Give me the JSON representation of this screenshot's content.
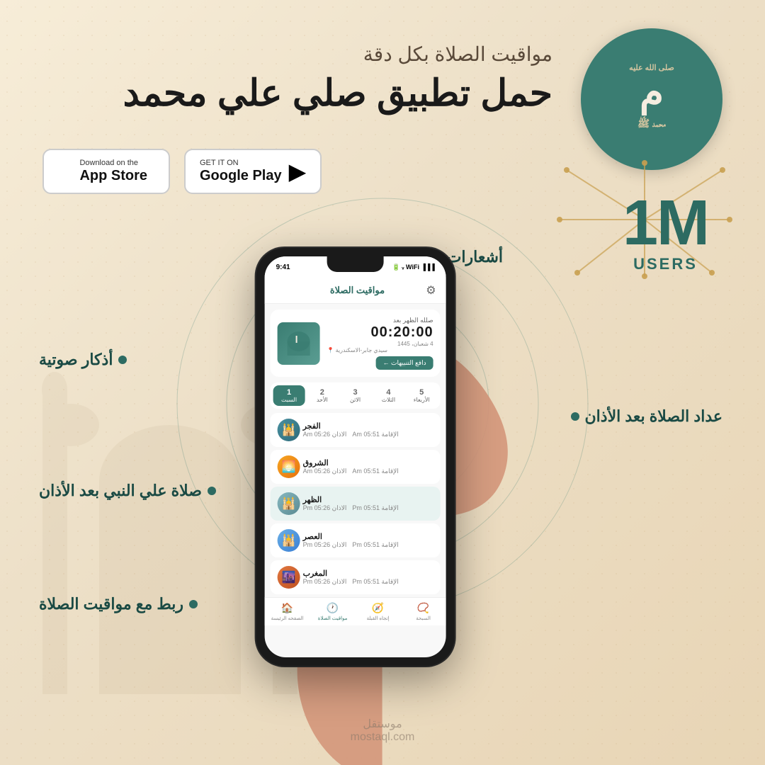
{
  "page": {
    "background": "#f5ede0"
  },
  "header": {
    "subtitle": "مواقيت الصلاة بكل دقة",
    "title": "حمل تطبيق صلي علي محمد"
  },
  "logo": {
    "symbol": "محمد",
    "background_color": "#3a7d72"
  },
  "million_badge": {
    "number": "1M",
    "label": "USERS"
  },
  "store_buttons": [
    {
      "id": "google-play",
      "pre_label": "GET IT ON",
      "name": "Google Play",
      "icon": "▶"
    },
    {
      "id": "app-store",
      "pre_label": "Download on the",
      "name": "App Store",
      "icon": ""
    }
  ],
  "features": [
    {
      "id": "custom-notifications",
      "text": "أشعارات مخصصط بعد الصلاة",
      "position": "top-right"
    },
    {
      "id": "audio-dhikr",
      "text": "أذكار صوتية",
      "position": "left-upper"
    },
    {
      "id": "prayer-count",
      "text": "عداد الصلاة بعد الأذان",
      "position": "right-middle"
    },
    {
      "id": "salawat",
      "text": "صلاة علي النبي بعد الأذان",
      "position": "left-lower"
    },
    {
      "id": "prayer-times-link",
      "text": "ربط مع مواقيت الصلاة",
      "position": "bottom-left"
    }
  ],
  "phone": {
    "time": "9:41",
    "app_title": "مواقيت الصلاة",
    "next_prayer_label": "صلله الظهر بعد",
    "countdown": "00:20:00",
    "date_hijri": "4 شعبان، 1445",
    "location": "سيدي جابر-الاسكندرية",
    "reminder_btn": "دافع التنبيهات ←",
    "days": [
      {
        "num": "1",
        "name": "السبت",
        "active": true
      },
      {
        "num": "2",
        "name": "الأحد",
        "active": false
      },
      {
        "num": "3",
        "name": "الاثن",
        "active": false
      },
      {
        "num": "4",
        "name": "الثلاث",
        "active": false
      },
      {
        "num": "5",
        "name": "الأربعاء",
        "active": false
      }
    ],
    "prayers": [
      {
        "name": "الفجر",
        "adhan": "05:26 Am",
        "iqama": "05:51 Am",
        "highlighted": false,
        "icon": "🕌"
      },
      {
        "name": "الشروق",
        "adhan": "05:26 Am",
        "iqama": "05:51 Am",
        "highlighted": false,
        "icon": "🌅"
      },
      {
        "name": "الظهر",
        "adhan": "05:26 Pm",
        "iqama": "05:51 Pm",
        "highlighted": true,
        "icon": "🕌"
      },
      {
        "name": "العصر",
        "adhan": "05:26 Pm",
        "iqama": "05:51 Pm",
        "highlighted": false,
        "icon": "🕌"
      },
      {
        "name": "المغرب",
        "adhan": "05:26 Pm",
        "iqama": "05:51 Pm",
        "highlighted": false,
        "icon": "🌆"
      }
    ],
    "nav_items": [
      {
        "id": "tasbih",
        "label": "السبحة",
        "icon": "📿",
        "active": false
      },
      {
        "id": "qibla",
        "label": "إتجاه القبلة",
        "icon": "🧭",
        "active": false
      },
      {
        "id": "prayer-times",
        "label": "مواقيت الصلاة",
        "icon": "🕐",
        "active": true
      },
      {
        "id": "home",
        "label": "الصفحه الرئيسة",
        "icon": "🏠",
        "active": false
      }
    ]
  },
  "watermark": {
    "arabic": "موستقل",
    "latin": "mostaql.com"
  }
}
